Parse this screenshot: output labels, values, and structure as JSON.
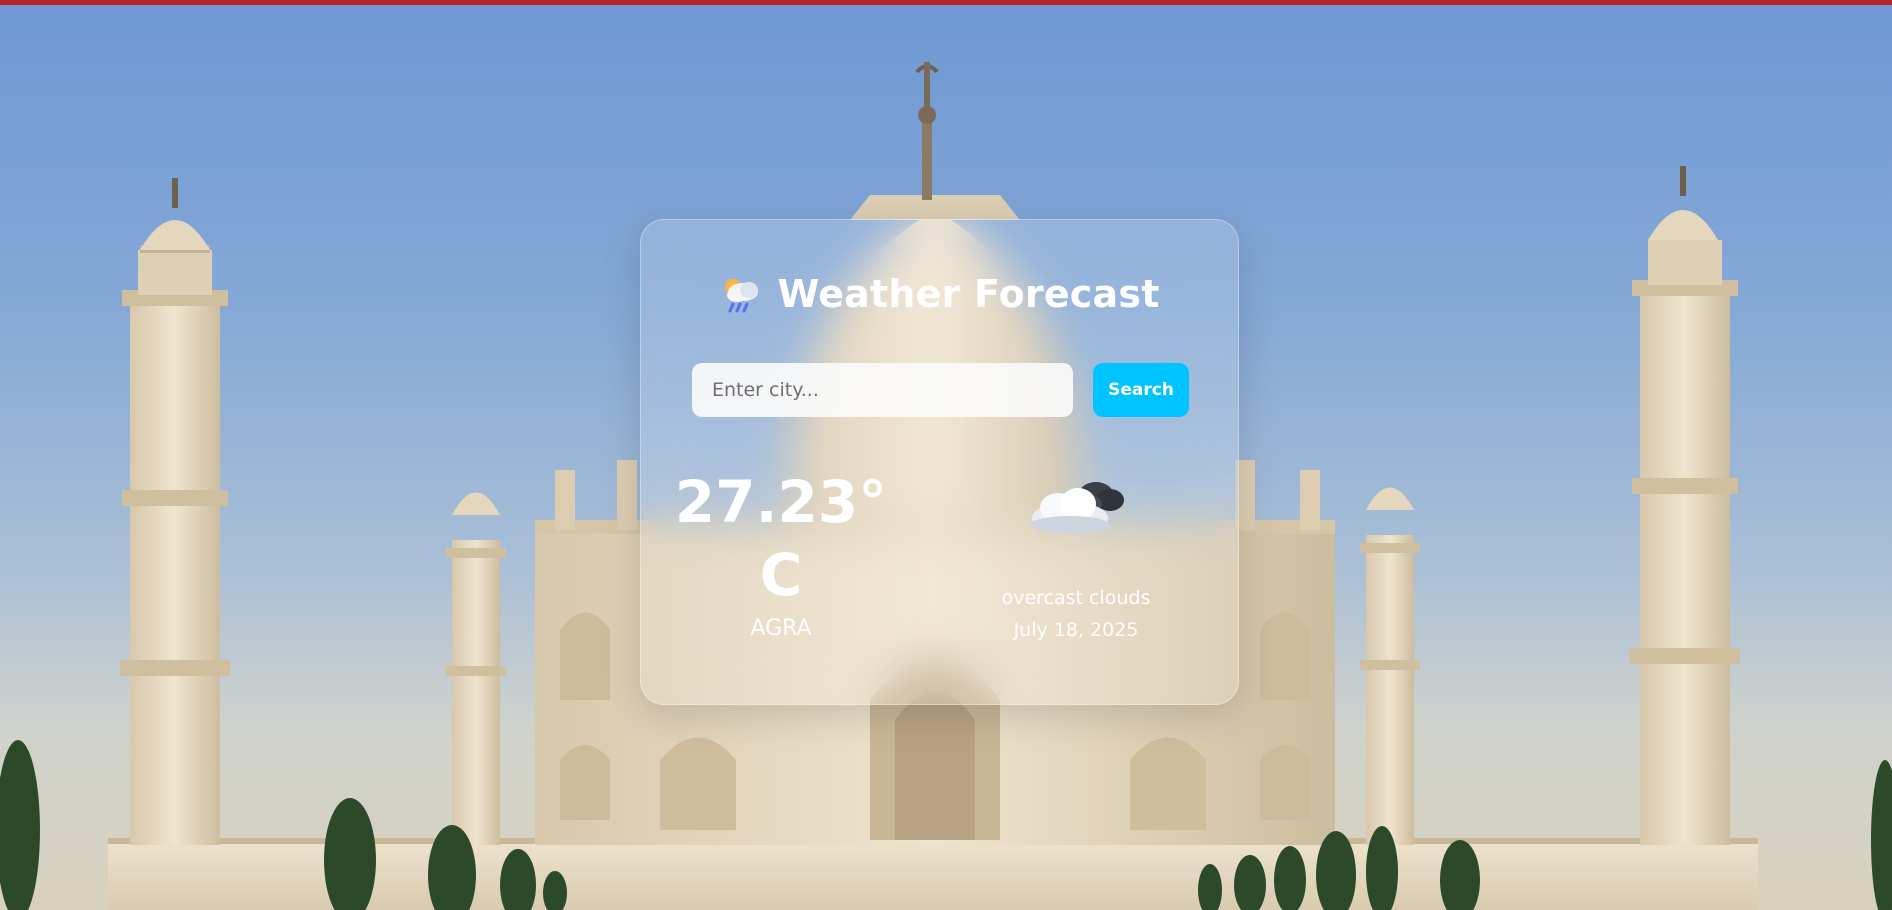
{
  "colors": {
    "top_strip": "#b8232a",
    "accent_button": "#00c4ff",
    "title_text": "#ffffff"
  },
  "background": {
    "image": "taj-mahal-photo"
  },
  "weather_card": {
    "title_icon": "cloud-sun-rain-icon",
    "title": "Weather Forecast",
    "search": {
      "value": "",
      "placeholder": "Enter city...",
      "button_label": "Search"
    },
    "temperature": "27.23° C",
    "city": "AGRA",
    "condition_icon": "overcast-clouds-icon",
    "condition": "overcast clouds",
    "date": "July 18, 2025"
  }
}
